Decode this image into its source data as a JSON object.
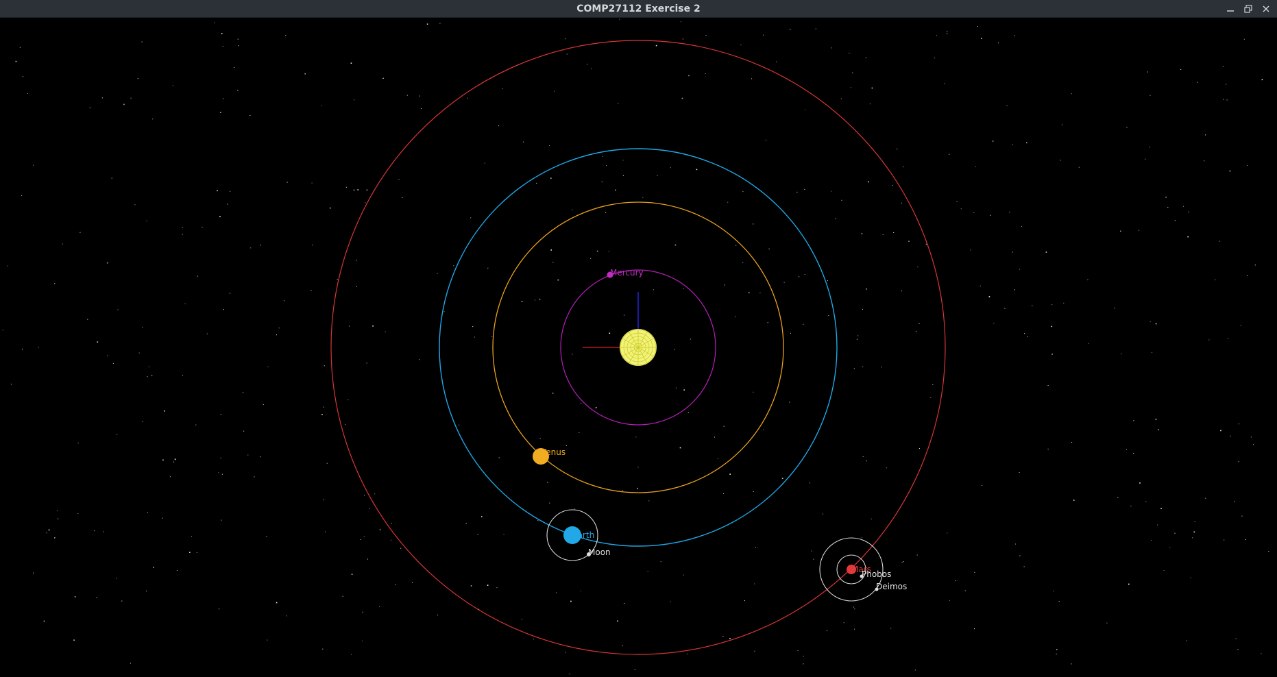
{
  "window": {
    "title": "COMP27112 Exercise 2",
    "controls": [
      {
        "name": "minimize-button",
        "icon": "minimize-icon"
      },
      {
        "name": "maximize-button",
        "icon": "maximize-icon"
      },
      {
        "name": "close-button",
        "icon": "close-icon"
      }
    ]
  },
  "scene": {
    "background": "#000000",
    "sun": {
      "color": "#f2f27a"
    },
    "axes": {
      "x_color": "#e02020",
      "y_color": "#2020d0"
    },
    "bodies": {
      "mercury": {
        "label": "Mercury",
        "color": "#c22ec2"
      },
      "venus": {
        "label": "Venus",
        "color": "#f2ac22"
      },
      "earth": {
        "label": "Earth",
        "color": "#22a8e6"
      },
      "moon": {
        "label": "Moon",
        "color": "#e0e0e0"
      },
      "mars": {
        "label": "Mars",
        "color": "#e23a3a"
      },
      "phobos": {
        "label": "Phobos",
        "color": "#e0e0e0"
      },
      "deimos": {
        "label": "Deimos",
        "color": "#e0e0e0"
      }
    },
    "orbit_colors": {
      "mercury": "#b420b4",
      "venus": "#e9a21e",
      "earth": "#1ea8e6",
      "mars": "#d83636",
      "moon": "#d8d8d8",
      "mars_moons": "#d8d8d8"
    }
  }
}
